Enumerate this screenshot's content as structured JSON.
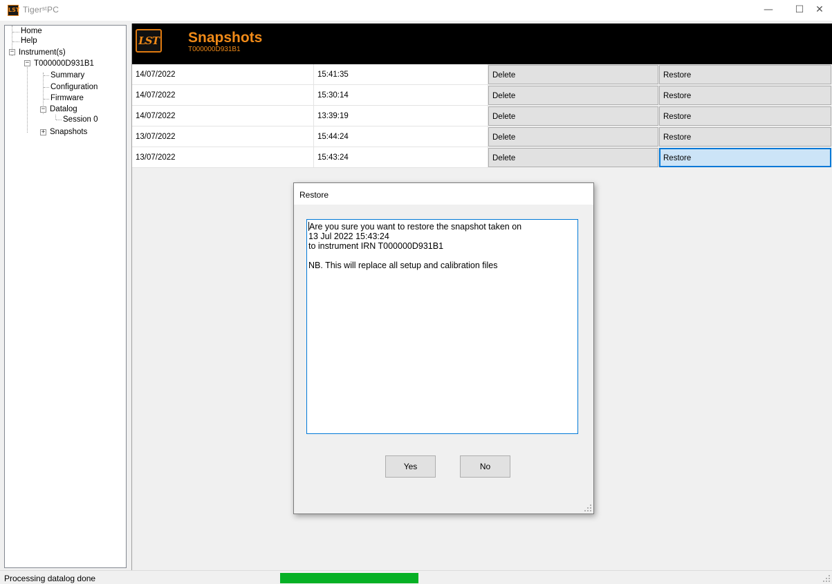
{
  "window": {
    "title": "TigerˢᵗPC",
    "app_icon_text": "LST",
    "minimize_glyph": "—",
    "maximize_glyph": "☐",
    "close_glyph": "✕"
  },
  "tree": {
    "items": [
      {
        "label": "Home"
      },
      {
        "label": "Help"
      },
      {
        "label": "Instrument(s)",
        "expanded": true
      },
      {
        "label": "T000000D931B1",
        "expanded": true
      },
      {
        "label": "Summary"
      },
      {
        "label": "Configuration"
      },
      {
        "label": "Firmware"
      },
      {
        "label": "Datalog",
        "expanded": true
      },
      {
        "label": "Session 0"
      },
      {
        "label": "Snapshots",
        "expanded": false
      }
    ],
    "expanded_glyph": "−",
    "collapsed_glyph": "+"
  },
  "header": {
    "logo_text": "LST",
    "title": "Snapshots",
    "subtitle": "T000000D931B1"
  },
  "snapshots": [
    {
      "date": "14/07/2022",
      "time": "15:41:35",
      "delete_label": "Delete",
      "restore_label": "Restore"
    },
    {
      "date": "14/07/2022",
      "time": "15:30:14",
      "delete_label": "Delete",
      "restore_label": "Restore"
    },
    {
      "date": "14/07/2022",
      "time": "13:39:19",
      "delete_label": "Delete",
      "restore_label": "Restore"
    },
    {
      "date": "13/07/2022",
      "time": "15:44:24",
      "delete_label": "Delete",
      "restore_label": "Restore"
    },
    {
      "date": "13/07/2022",
      "time": "15:43:24",
      "delete_label": "Delete",
      "restore_label": "Restore"
    }
  ],
  "dialog": {
    "title": "Restore",
    "message": "Are you sure you want to restore the snapshot taken on\n13 Jul 2022 15:43:24\nto instrument IRN T000000D931B1\n\nNB. This will replace all setup and calibration files",
    "yes_label": "Yes",
    "no_label": "No"
  },
  "status": {
    "text": "Processing datalog done",
    "progress_fraction": 1.0,
    "colors": {
      "progress": "#06b025",
      "accent": "#f08a18",
      "focus": "#0078d7"
    }
  }
}
